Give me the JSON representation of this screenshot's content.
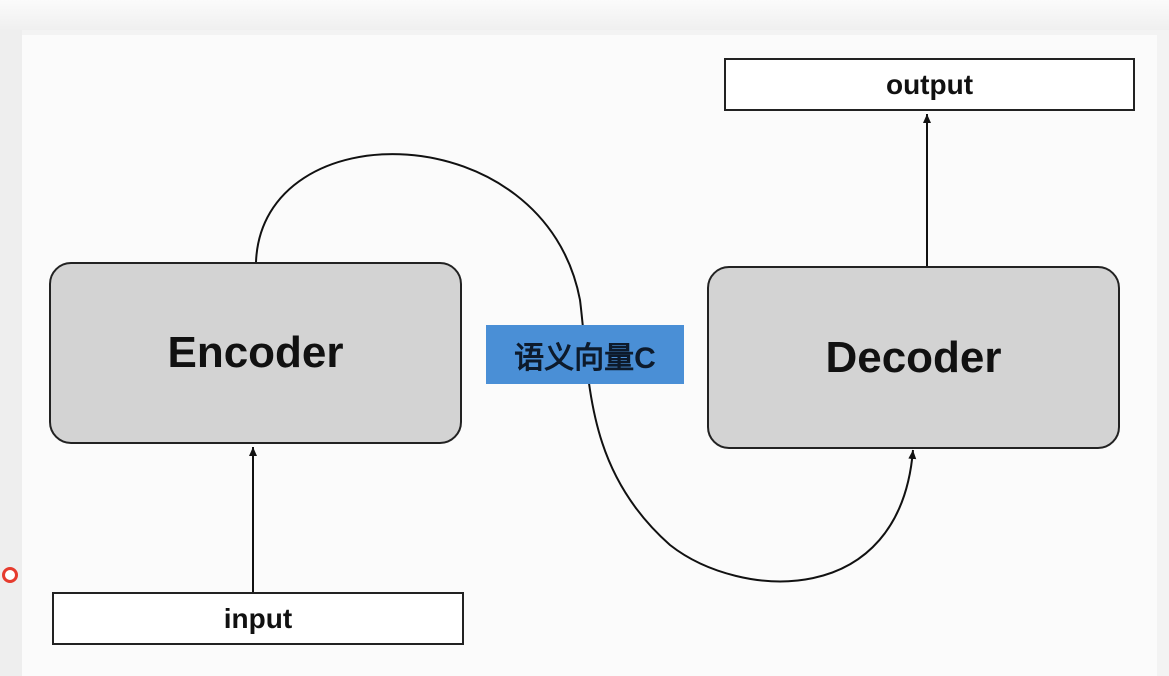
{
  "diagram": {
    "encoder": {
      "label": "Encoder"
    },
    "decoder": {
      "label": "Decoder"
    },
    "input": {
      "label": "input"
    },
    "output": {
      "label": "output"
    },
    "context_vector": {
      "label": "语义向量C",
      "color": "#4a8fd6"
    }
  }
}
